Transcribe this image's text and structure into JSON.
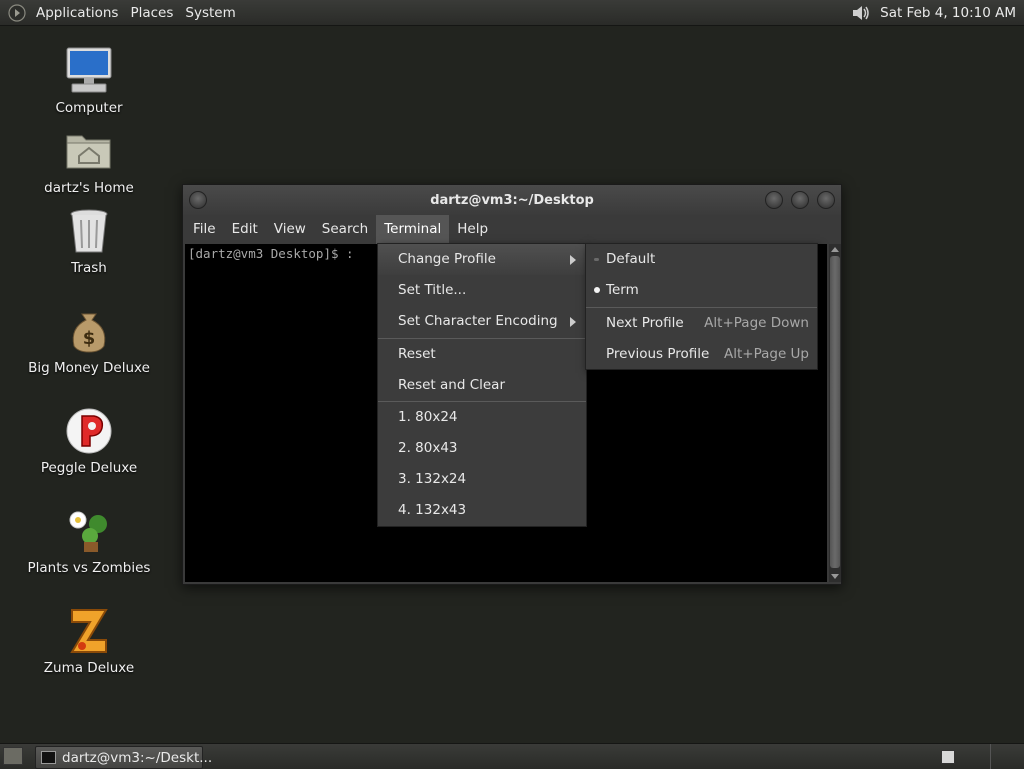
{
  "top_panel": {
    "menus": [
      "Applications",
      "Places",
      "System"
    ],
    "clock": "Sat Feb  4, 10:10 AM",
    "icons": [
      "gnome-foot-icon",
      "volume-icon"
    ]
  },
  "desktop": {
    "icons": [
      {
        "label": "Computer",
        "icon": "computer-icon"
      },
      {
        "label": "dartz's Home",
        "icon": "home-folder-icon"
      },
      {
        "label": "Trash",
        "icon": "trash-icon"
      },
      {
        "label": "Big Money Deluxe",
        "icon": "money-bag-icon"
      },
      {
        "label": "Peggle Deluxe",
        "icon": "peggle-icon"
      },
      {
        "label": "Plants vs Zombies",
        "icon": "plants-icon"
      },
      {
        "label": "Zuma Deluxe",
        "icon": "zuma-icon"
      }
    ]
  },
  "terminal": {
    "title": "dartz@vm3:~/Desktop",
    "menubar": [
      "File",
      "Edit",
      "View",
      "Search",
      "Terminal",
      "Help"
    ],
    "active_menu": "Terminal",
    "prompt": "[dartz@vm3 Desktop]$ :"
  },
  "terminal_menu": {
    "items": [
      {
        "label": "Change Profile",
        "submenu": true,
        "highlighted": true
      },
      {
        "label": "Set Title...",
        "submenu": false
      },
      {
        "label": "Set Character Encoding",
        "submenu": true
      },
      {
        "label": "Reset",
        "submenu": false
      },
      {
        "label": "Reset and Clear",
        "submenu": false
      },
      {
        "label": "1. 80x24",
        "submenu": false
      },
      {
        "label": "2. 80x43",
        "submenu": false
      },
      {
        "label": "3. 132x24",
        "submenu": false
      },
      {
        "label": "4. 132x43",
        "submenu": false
      }
    ]
  },
  "profile_menu": {
    "items": [
      {
        "label": "Default",
        "selected": false
      },
      {
        "label": "Term",
        "selected": true
      },
      {
        "label": "Next Profile",
        "accel": "Alt+Page Down"
      },
      {
        "label": "Previous Profile",
        "accel": "Alt+Page Up"
      }
    ]
  },
  "bottom_panel": {
    "task_label": "dartz@vm3:~/Deskt..."
  },
  "colors": {
    "desktop_bg": "#22241f",
    "panel_bg": "#33342f",
    "menu_bg": "#3c3c3c",
    "terminal_bg": "#000000"
  }
}
